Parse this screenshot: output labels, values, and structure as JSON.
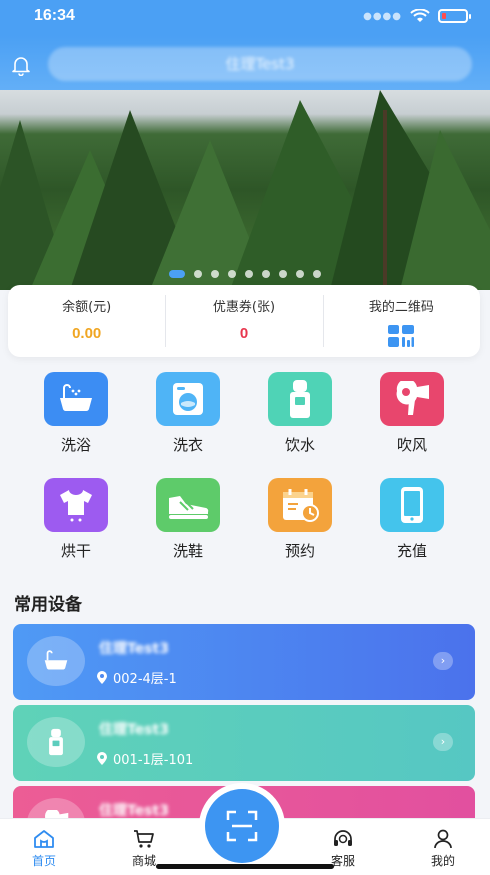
{
  "status_bar": {
    "time": "16:34",
    "battery_level": 0.2
  },
  "header": {
    "search_text": "住理Test3"
  },
  "banner": {
    "dot_count": 9,
    "active_dot": 0
  },
  "stats": [
    {
      "label": "余额(元)",
      "value": "0.00",
      "color": "#f0a623"
    },
    {
      "label": "优惠券(张)",
      "value": "0",
      "color": "#e8374e"
    },
    {
      "label": "我的二维码",
      "icon": "qr-grid-icon"
    }
  ],
  "services": [
    {
      "label": "洗浴",
      "icon": "bathtub-icon",
      "color": "#3c8df3"
    },
    {
      "label": "洗衣",
      "icon": "washing-machine-icon",
      "color": "#4fb4f6"
    },
    {
      "label": "饮水",
      "icon": "water-dispenser-icon",
      "color": "#4fd3b6"
    },
    {
      "label": "吹风",
      "icon": "hair-dryer-icon",
      "color": "#e8466d"
    },
    {
      "label": "烘干",
      "icon": "tshirt-icon",
      "color": "#9d5bf0"
    },
    {
      "label": "洗鞋",
      "icon": "sneaker-icon",
      "color": "#5ecb6a"
    },
    {
      "label": "预约",
      "icon": "calendar-clock-icon",
      "color": "#f3a33c"
    },
    {
      "label": "充值",
      "icon": "phone-icon",
      "color": "#44c4ec"
    }
  ],
  "section": {
    "title": "常用设备"
  },
  "devices": [
    {
      "name": "住理Test3",
      "location": "002-4层-1",
      "icon": "bathtub-icon",
      "color_from": "#4f9af5",
      "color_to": "#4b72ec"
    },
    {
      "name": "住理Test3",
      "location": "001-1层-101",
      "icon": "water-dispenser-icon",
      "color_from": "#5fd2b8",
      "color_to": "#56c7c3"
    },
    {
      "name": "住理Test3",
      "location": "",
      "icon": "hair-dryer-icon",
      "color_from": "#ec5d95",
      "color_to": "#e2509f"
    }
  ],
  "tabbar": [
    {
      "label": "首页",
      "icon": "home-icon",
      "active": true
    },
    {
      "label": "商城",
      "icon": "cart-icon",
      "active": false
    },
    {
      "label": "客服",
      "icon": "headset-icon",
      "active": false
    },
    {
      "label": "我的",
      "icon": "user-icon",
      "active": false
    }
  ],
  "scan_button": {
    "icon": "scan-icon"
  }
}
